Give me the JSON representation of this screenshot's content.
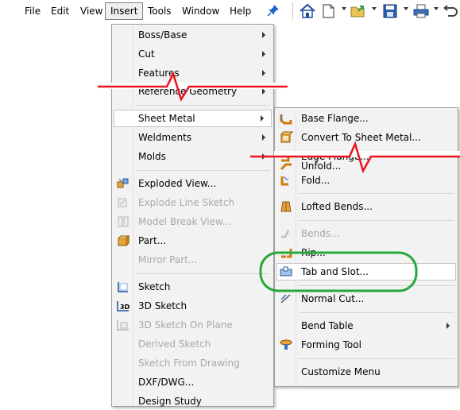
{
  "menubar": {
    "items": [
      {
        "key": "file",
        "label": "File"
      },
      {
        "key": "edit",
        "label": "Edit"
      },
      {
        "key": "view",
        "label": "View"
      },
      {
        "key": "insert",
        "label": "Insert"
      },
      {
        "key": "tools",
        "label": "Tools"
      },
      {
        "key": "window",
        "label": "Window"
      },
      {
        "key": "help",
        "label": "Help"
      }
    ],
    "active": "Insert"
  },
  "toolbar": {
    "icons": [
      "home-icon",
      "new-document-icon",
      "open-folder-icon",
      "save-icon",
      "print-icon",
      "undo-icon"
    ]
  },
  "insert_menu": {
    "items": [
      {
        "label": "Boss/Base",
        "submenu": true,
        "enabled": true
      },
      {
        "label": "Cut",
        "submenu": true,
        "enabled": true
      },
      {
        "label": "Features",
        "submenu": true,
        "enabled": true
      },
      {
        "label": "Reference Geometry",
        "submenu": true,
        "enabled": true
      },
      {
        "label": "Sheet Metal",
        "submenu": true,
        "enabled": true,
        "highlighted": true
      },
      {
        "label": "Weldments",
        "submenu": true,
        "enabled": true
      },
      {
        "label": "Molds",
        "submenu": true,
        "enabled": true
      },
      {
        "label": "Exploded View...",
        "enabled": true
      },
      {
        "label": "Explode Line Sketch",
        "enabled": false
      },
      {
        "label": "Model Break View...",
        "enabled": false
      },
      {
        "label": "Part...",
        "enabled": true
      },
      {
        "label": "Mirror Part...",
        "enabled": false
      },
      {
        "label": "Sketch",
        "enabled": true
      },
      {
        "label": "3D Sketch",
        "enabled": true
      },
      {
        "label": "3D Sketch On Plane",
        "enabled": false
      },
      {
        "label": "Derived Sketch",
        "enabled": false
      },
      {
        "label": "Sketch From Drawing",
        "enabled": false
      },
      {
        "label": "DXF/DWG...",
        "enabled": true
      },
      {
        "label": "Design Study",
        "enabled": true
      }
    ]
  },
  "sheet_metal_menu": {
    "items": [
      {
        "label": "Base Flange...",
        "enabled": true
      },
      {
        "label": "Convert To Sheet Metal...",
        "enabled": true
      },
      {
        "label": "Edge Flange...",
        "enabled": true
      },
      {
        "label": "Unfold...",
        "enabled": true
      },
      {
        "label": "Fold...",
        "enabled": true
      },
      {
        "label": "Lofted Bends...",
        "enabled": true
      },
      {
        "label": "Bends...",
        "enabled": false
      },
      {
        "label": "Rip...",
        "enabled": true
      },
      {
        "label": "Tab and Slot...",
        "enabled": true,
        "highlighted": true
      },
      {
        "label": "Normal Cut...",
        "enabled": true
      },
      {
        "label": "Bend Table",
        "enabled": true,
        "submenu": true
      },
      {
        "label": "Forming Tool",
        "enabled": true
      },
      {
        "label": "Customize Menu",
        "enabled": true
      }
    ]
  },
  "colors": {
    "break_line": "#e8141e",
    "highlight_ellipse": "#27a83a",
    "menu_bg": "#f2f2f2",
    "disabled_text": "#a8a8a8"
  }
}
